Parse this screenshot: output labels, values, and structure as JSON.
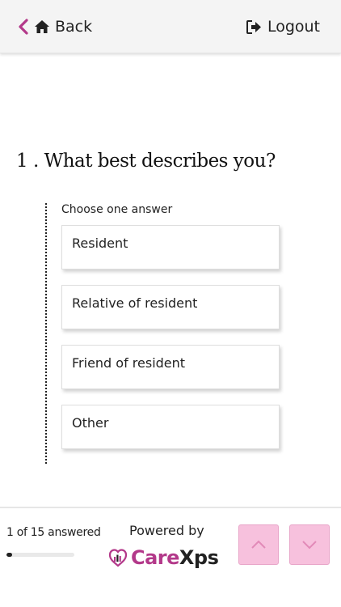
{
  "header": {
    "back_label": "Back",
    "logout_label": "Logout"
  },
  "question": {
    "number": "1",
    "text": "1 . What best describes you?",
    "instruction": "Choose one answer",
    "options": [
      "Resident",
      "Relative of resident",
      "Friend of resident",
      "Other"
    ]
  },
  "footer": {
    "answered_text": "1 of 15 answered",
    "answered": 1,
    "total": 15,
    "powered_by": "Powered by",
    "brand_part1": "Care",
    "brand_part2": "Xps"
  },
  "colors": {
    "accent": "#b3398a",
    "nav_button": "#f7c1dd"
  }
}
